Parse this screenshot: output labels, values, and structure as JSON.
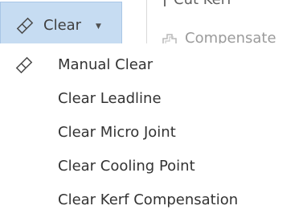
{
  "ribbon": {
    "clear_label": "Clear",
    "compensate_label": "Compensate",
    "kerf_label_fragment": "Cut Kerf",
    "clear_icon": "eraser-icon",
    "caret_icon": "caret-down-icon",
    "compensate_icon": "compensate-icon"
  },
  "menu": {
    "items": [
      {
        "label": "Manual Clear",
        "icon": "eraser-icon"
      },
      {
        "label": "Clear Leadline"
      },
      {
        "label": "Clear Micro Joint"
      },
      {
        "label": "Clear Cooling Point"
      },
      {
        "label": "Clear Kerf Compensation"
      }
    ]
  }
}
